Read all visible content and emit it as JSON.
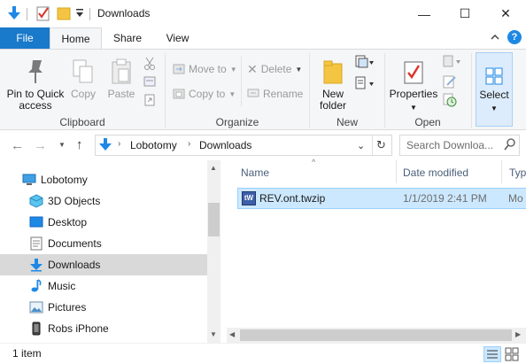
{
  "window": {
    "title": "Downloads",
    "minimize_glyph": "—",
    "maximize_glyph": "☐",
    "close_glyph": "✕"
  },
  "ribbon_tabs": [
    "File",
    "Home",
    "Share",
    "View"
  ],
  "ribbon": {
    "clipboard": {
      "label": "Clipboard",
      "pin_line1": "Pin to Quick",
      "pin_line2": "access",
      "copy": "Copy",
      "paste": "Paste"
    },
    "organize": {
      "label": "Organize",
      "move_to": "Move to",
      "copy_to": "Copy to",
      "delete": "Delete",
      "rename": "Rename"
    },
    "new": {
      "label": "New",
      "new_folder_line1": "New",
      "new_folder_line2": "folder"
    },
    "open": {
      "label": "Open",
      "properties": "Properties"
    },
    "select": {
      "select": "Select"
    }
  },
  "address": {
    "crumbs": [
      "Lobotomy",
      "Downloads"
    ],
    "search_placeholder": "Search Downloa..."
  },
  "nav_pane": {
    "items": [
      {
        "label": "Lobotomy",
        "icon": "computer-icon"
      },
      {
        "label": "3D Objects",
        "icon": "3d-objects-icon"
      },
      {
        "label": "Desktop",
        "icon": "desktop-icon"
      },
      {
        "label": "Documents",
        "icon": "documents-icon"
      },
      {
        "label": "Downloads",
        "icon": "download-arrow-icon",
        "selected": true
      },
      {
        "label": "Music",
        "icon": "music-note-icon"
      },
      {
        "label": "Pictures",
        "icon": "pictures-icon"
      },
      {
        "label": "Robs iPhone",
        "icon": "phone-icon"
      }
    ]
  },
  "file_list": {
    "columns": [
      "Name",
      "Date modified",
      "Typ"
    ],
    "rows": [
      {
        "icon_text": "tW",
        "name": "REV.ont.twzip",
        "date": "1/1/2019 2:41 PM",
        "type": "Mo"
      }
    ]
  },
  "status": {
    "item_count": "1 item"
  },
  "colors": {
    "file_tab": "#1979ca",
    "selection": "#cce8ff",
    "selection_border": "#99d1ff",
    "nav_selected": "#d9d9d9",
    "accent_blue": "#1e88e5"
  }
}
